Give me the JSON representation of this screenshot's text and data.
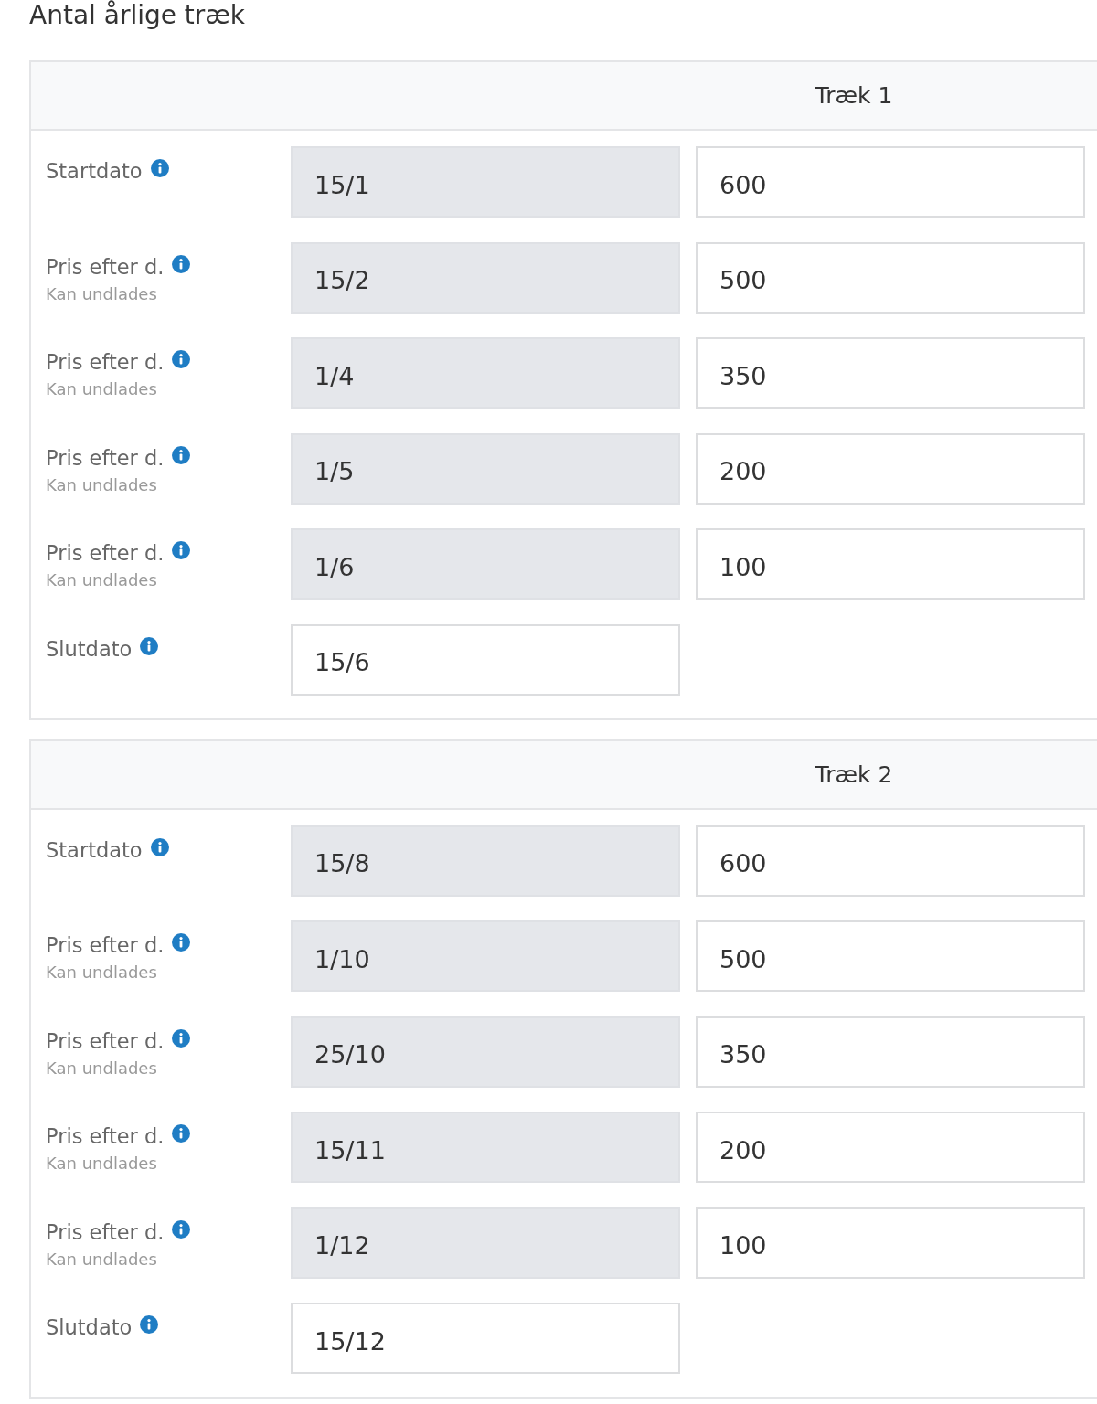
{
  "title": "Antal årlige træk",
  "draws": [
    {
      "heading": "Træk 1",
      "rows": [
        {
          "label": "Startdato",
          "date": {
            "value": "15/1",
            "disabled": true
          },
          "price": {
            "value": "600"
          }
        },
        {
          "label": "Pris efter d.",
          "hint": "Kan undlades",
          "date": {
            "value": "15/2",
            "disabled": true
          },
          "price": {
            "value": "500"
          }
        },
        {
          "label": "Pris efter d.",
          "hint": "Kan undlades",
          "date": {
            "value": "1/4",
            "disabled": true
          },
          "price": {
            "value": "350"
          }
        },
        {
          "label": "Pris efter d.",
          "hint": "Kan undlades",
          "date": {
            "value": "1/5",
            "disabled": true
          },
          "price": {
            "value": "200"
          }
        },
        {
          "label": "Pris efter d.",
          "hint": "Kan undlades",
          "date": {
            "value": "1/6",
            "disabled": true
          },
          "price": {
            "value": "100"
          }
        },
        {
          "label": "Slutdato",
          "date": {
            "value": "15/6",
            "disabled": false
          }
        }
      ]
    },
    {
      "heading": "Træk 2",
      "rows": [
        {
          "label": "Startdato",
          "date": {
            "value": "15/8",
            "disabled": true
          },
          "price": {
            "value": "600"
          }
        },
        {
          "label": "Pris efter d.",
          "hint": "Kan undlades",
          "date": {
            "value": "1/10",
            "disabled": true
          },
          "price": {
            "value": "500"
          }
        },
        {
          "label": "Pris efter d.",
          "hint": "Kan undlades",
          "date": {
            "value": "25/10",
            "disabled": true
          },
          "price": {
            "value": "350"
          }
        },
        {
          "label": "Pris efter d.",
          "hint": "Kan undlades",
          "date": {
            "value": "15/11",
            "disabled": true
          },
          "price": {
            "value": "200"
          }
        },
        {
          "label": "Pris efter d.",
          "hint": "Kan undlades",
          "date": {
            "value": "1/12",
            "disabled": true
          },
          "price": {
            "value": "100"
          }
        },
        {
          "label": "Slutdato",
          "date": {
            "value": "15/12",
            "disabled": false
          }
        }
      ]
    }
  ]
}
